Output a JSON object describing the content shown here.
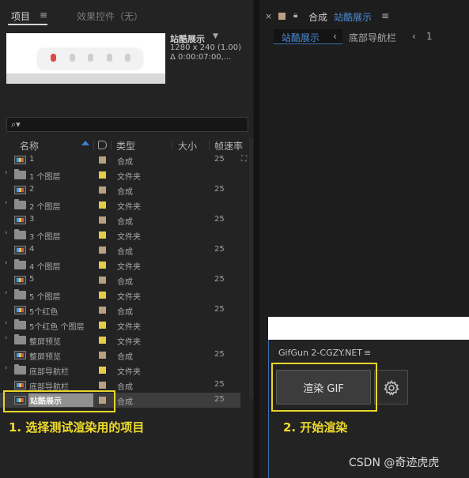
{
  "project_panel": {
    "tab_label": "项目",
    "tab_menu": "≡",
    "effects_tab": "效果控件（无）",
    "selected_comp": {
      "name": "站酷展示",
      "dropdown": "▼",
      "size": "1280 x 240 (1.00)",
      "duration": "Δ 0:00:07:00,..."
    },
    "search_icon": "⌕▾",
    "columns": {
      "name": "名称",
      "type": "类型",
      "size": "大小",
      "fps": "帧速率"
    },
    "items": [
      {
        "name": "1",
        "type": "合成",
        "fps": "25",
        "kind": "comp",
        "expand": "",
        "swatch": "#b8a081"
      },
      {
        "name": "1 个图层",
        "type": "文件夹",
        "fps": "",
        "kind": "folder",
        "expand": "›",
        "swatch": "#e4cc4a"
      },
      {
        "name": "2",
        "type": "合成",
        "fps": "25",
        "kind": "comp",
        "expand": "",
        "swatch": "#b8a081"
      },
      {
        "name": "2 个图层",
        "type": "文件夹",
        "fps": "",
        "kind": "folder",
        "expand": "›",
        "swatch": "#e4cc4a"
      },
      {
        "name": "3",
        "type": "合成",
        "fps": "25",
        "kind": "comp",
        "expand": "",
        "swatch": "#b8a081"
      },
      {
        "name": "3 个图层",
        "type": "文件夹",
        "fps": "",
        "kind": "folder",
        "expand": "›",
        "swatch": "#e4cc4a"
      },
      {
        "name": "4",
        "type": "合成",
        "fps": "25",
        "kind": "comp",
        "expand": "",
        "swatch": "#b8a081"
      },
      {
        "name": "4 个图层",
        "type": "文件夹",
        "fps": "",
        "kind": "folder",
        "expand": "›",
        "swatch": "#e4cc4a"
      },
      {
        "name": "5",
        "type": "合成",
        "fps": "25",
        "kind": "comp",
        "expand": "",
        "swatch": "#b8a081"
      },
      {
        "name": "5 个图层",
        "type": "文件夹",
        "fps": "",
        "kind": "folder",
        "expand": "›",
        "swatch": "#e4cc4a"
      },
      {
        "name": "5个红色",
        "type": "合成",
        "fps": "25",
        "kind": "comp",
        "expand": "",
        "swatch": "#b8a081"
      },
      {
        "name": "5个红色 个图层",
        "type": "文件夹",
        "fps": "",
        "kind": "folder",
        "expand": "›",
        "swatch": "#e4cc4a"
      },
      {
        "name": "整屏预览",
        "type": "文件夹",
        "fps": "",
        "kind": "folder",
        "expand": "›",
        "swatch": "#e4cc4a"
      },
      {
        "name": "整屏预览",
        "type": "合成",
        "fps": "25",
        "kind": "comp",
        "expand": "",
        "swatch": "#b8a081"
      },
      {
        "name": "底部导航栏",
        "type": "文件夹",
        "fps": "",
        "kind": "folder",
        "expand": "›",
        "swatch": "#e4cc4a"
      },
      {
        "name": "底部导航栏",
        "type": "合成",
        "fps": "25",
        "kind": "comp",
        "expand": "",
        "swatch": "#b8a081"
      },
      {
        "name": "站酷展示",
        "type": "合成",
        "fps": "25",
        "kind": "comp",
        "expand": "",
        "swatch": "#b8a081",
        "selected": true
      }
    ],
    "annotation": "1. 选择测试渲染用的项目"
  },
  "comp_panel": {
    "close": "×",
    "title_prefix": "合成",
    "title_name": "站酷展示",
    "menu": "≡",
    "breadcrumb_active": "站酷展示",
    "breadcrumb_other": "底部导航栏",
    "breadcrumb_arrow": "‹",
    "breadcrumb_count": "1"
  },
  "gifgun": {
    "title": "GifGun 2-CGZY.NET",
    "menu": "≡",
    "render_button": "渲染 GIF",
    "annotation": "2. 开始渲染"
  },
  "watermark": "CSDN @奇迹虎虎",
  "colors": {
    "accent_blue": "#4c8ed8",
    "highlight_yellow": "#e8d62c",
    "annotation_yellow": "#f0dc2c"
  }
}
